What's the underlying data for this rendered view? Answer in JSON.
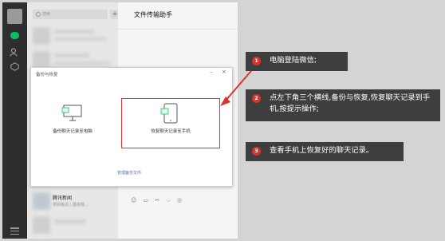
{
  "search": {
    "placeholder": "搜索",
    "add_label": "+"
  },
  "chat": {
    "title": "文件传输助手"
  },
  "toolbar": {
    "icons": "☺ ▭ ✂ ⌵ ◎"
  },
  "dialog": {
    "title": "备份与恢复",
    "min_label": "–",
    "close_label": "×",
    "option_pc": "备份聊天记录至电脑",
    "option_phone": "恢复聊天记录至手机",
    "manage_link": "管理备份文件"
  },
  "chat_items": [
    {
      "name": "腾讯新闻",
      "preview": "早间看点丨国务院..."
    }
  ],
  "callouts": [
    {
      "number": "1",
      "text": "电脑登陆微信;"
    },
    {
      "number": "2",
      "text": "点左下角三个横线,备份与恢复,恢复聊天记录到手机,按提示操作;"
    },
    {
      "number": "3",
      "text": "查看手机上恢复好的聊天记录。"
    }
  ],
  "colors": {
    "accent_red": "#e03131",
    "callout_bg": "#3e3e3e",
    "wechat_green": "#07c160"
  }
}
